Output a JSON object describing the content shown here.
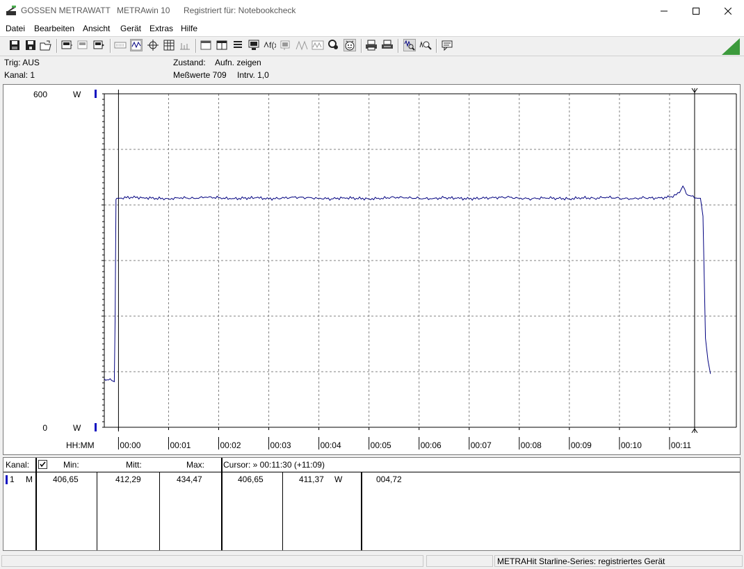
{
  "window": {
    "company": "GOSSEN METRAWATT",
    "app": "METRAwin 10",
    "registered": "Registriert für: Notebookcheck"
  },
  "menu": [
    "Datei",
    "Bearbeiten",
    "Ansicht",
    "Gerät",
    "Extras",
    "Hilfe"
  ],
  "info": {
    "trig": "Trig: AUS",
    "kanal": "Kanal: 1",
    "zustand_label": "Zustand:",
    "zustand_value": "Aufn. zeigen",
    "messwerte": "Meßwerte 709",
    "intrv": "Intrv. 1,0"
  },
  "chart_data": {
    "type": "line",
    "ylim": [
      0,
      600
    ],
    "y_top_label": "600",
    "y_bottom_label": "0",
    "unit": "W",
    "x_axis_label": "HH:MM",
    "x_ticks": [
      "00:00",
      "00:01",
      "00:02",
      "00:03",
      "00:04",
      "00:05",
      "00:06",
      "00:07",
      "00:08",
      "00:09",
      "00:10",
      "00:11"
    ],
    "xlim_seconds": [
      -17,
      740
    ],
    "cursor_seconds": 690,
    "grid": true,
    "series": [
      {
        "color": "#00007f",
        "x": [
          -17,
          -12,
          -8,
          -5,
          -4,
          -3,
          -2,
          0,
          15,
          30,
          45,
          60,
          75,
          90,
          105,
          120,
          135,
          150,
          165,
          180,
          195,
          210,
          225,
          240,
          255,
          270,
          285,
          300,
          315,
          330,
          345,
          360,
          375,
          390,
          405,
          420,
          435,
          450,
          465,
          480,
          495,
          510,
          525,
          540,
          555,
          570,
          585,
          600,
          615,
          630,
          645,
          660,
          668,
          672,
          676,
          680,
          686,
          690,
          693,
          697,
          700,
          703,
          706,
          709
        ],
        "y": [
          87,
          85,
          84,
          82,
          200,
          410,
          412,
          412,
          414,
          413,
          412,
          411,
          413,
          412,
          414,
          413,
          411,
          412,
          413,
          411,
          412,
          414,
          413,
          412,
          411,
          413,
          412,
          411,
          412,
          414,
          413,
          412,
          411,
          413,
          412,
          411,
          412,
          413,
          414,
          412,
          411,
          413,
          412,
          411,
          413,
          412,
          414,
          412,
          411,
          413,
          412,
          414,
          418,
          422,
          434,
          420,
          416,
          412,
          412,
          412,
          380,
          160,
          120,
          96
        ]
      }
    ]
  },
  "table": {
    "kanal_label": "Kanal:",
    "min_label": "Min:",
    "mitt_label": "Mitt:",
    "max_label": "Max:",
    "cursor_label": "Cursor: » 00:11:30 (+11:09)",
    "row": {
      "channel": "1",
      "mode": "M",
      "min": "406,65",
      "mitt": "412,29",
      "max": "434,47",
      "cursor_value": "406,65",
      "cursor_value2": "411,37",
      "unit": "W",
      "extra": "004,72"
    }
  },
  "status": {
    "text": "METRAHit Starline-Series: registriertes Gerät"
  },
  "colors": {
    "trace": "#00007f",
    "grid": "#808080",
    "accent_green": "#3c9a3c"
  },
  "toolbar_icons": [
    "save-icon",
    "save-as-icon",
    "open-icon",
    "device-icon",
    "device-off-icon",
    "device-start-icon",
    "keyboard-icon",
    "wave-icon",
    "target-icon",
    "table-icon",
    "bars-icon",
    "window-icon",
    "window-split-icon",
    "list-icon",
    "monitor-icon",
    "fx-icon",
    "signal-icon",
    "oscillo-icon",
    "oscillo2-icon",
    "settings-icon",
    "smiley-icon",
    "print-icon",
    "print-preview-icon",
    "zoom-wave-icon",
    "zoom-icon",
    "comment-icon"
  ]
}
